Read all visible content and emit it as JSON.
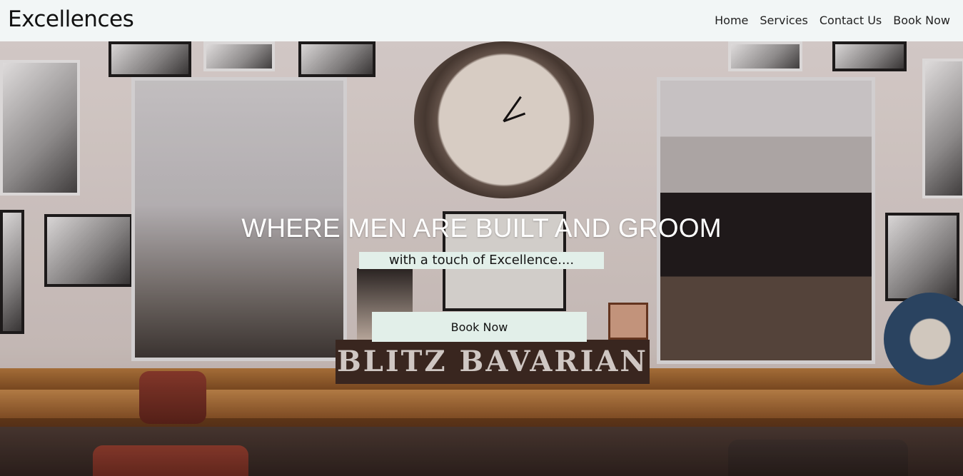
{
  "brand": "Excellences",
  "nav": {
    "items": [
      "Home",
      "Services",
      "Contact Us",
      "Book Now"
    ]
  },
  "hero": {
    "headline": "WHERE MEN ARE BUILT AND GROOM",
    "subline": "with a touch of Excellence....",
    "cta_label": "Book Now",
    "sign_text": "BLITZ BAVARIAN"
  },
  "colors": {
    "navbar_bg": "#f2f6f6",
    "accent_bg": "#e2efe9",
    "headline": "#ffffff"
  }
}
